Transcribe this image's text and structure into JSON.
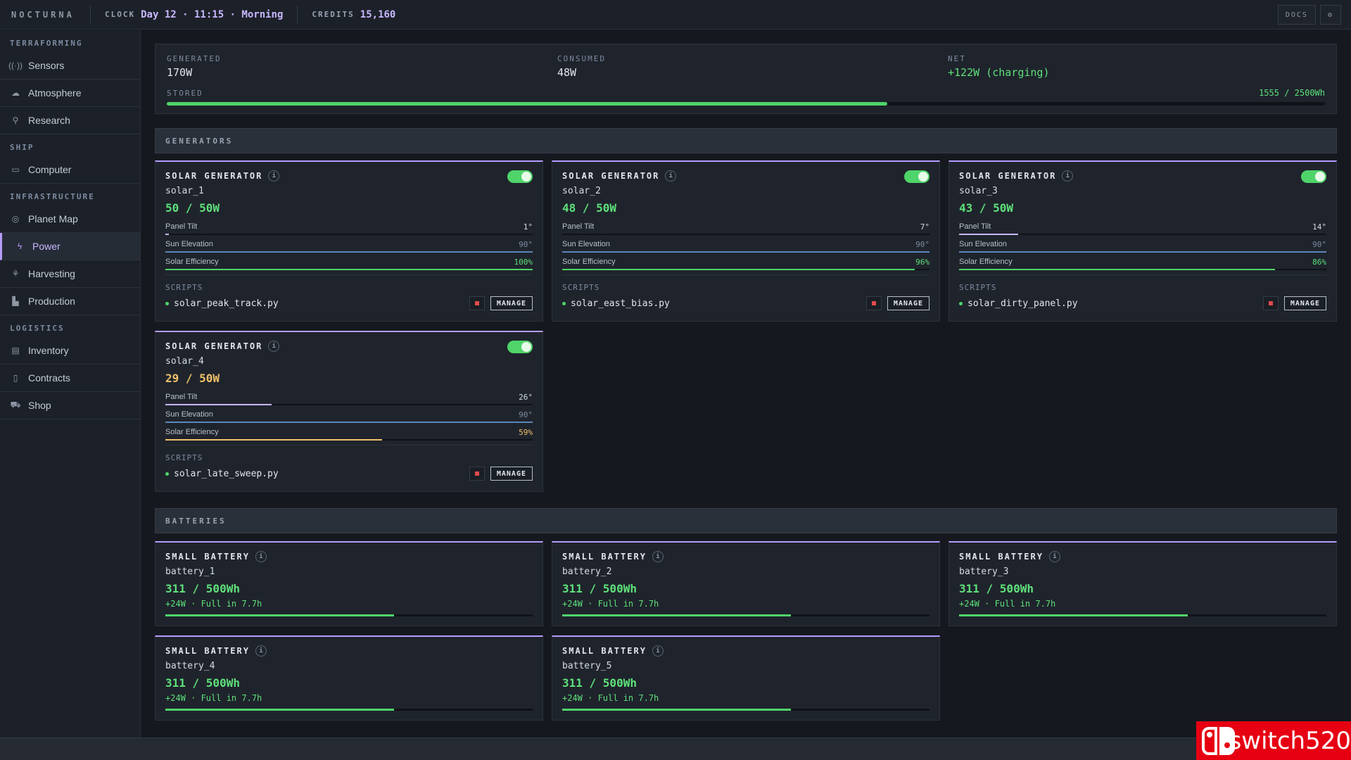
{
  "header": {
    "brand": "NOCTURNA",
    "clock_label": "CLOCK",
    "clock_value": "Day 12 · 11:15 · Morning",
    "credits_label": "CREDITS",
    "credits_value": "15,160",
    "docs_label": "DOCS",
    "settings_icon": "gear-icon"
  },
  "sidebar": {
    "sections": [
      {
        "title": "TERRAFORMING",
        "items": [
          {
            "label": "Sensors",
            "icon": "sensor-icon"
          },
          {
            "label": "Atmosphere",
            "icon": "cloud-icon"
          },
          {
            "label": "Research",
            "icon": "search-icon"
          }
        ]
      },
      {
        "title": "SHIP",
        "items": [
          {
            "label": "Computer",
            "icon": "monitor-icon"
          }
        ]
      },
      {
        "title": "INFRASTRUCTURE",
        "items": [
          {
            "label": "Planet Map",
            "icon": "globe-icon"
          },
          {
            "label": "Power",
            "icon": "lightning-icon",
            "active": true
          },
          {
            "label": "Harvesting",
            "icon": "sprout-icon"
          },
          {
            "label": "Production",
            "icon": "factory-icon"
          }
        ]
      },
      {
        "title": "LOGISTICS",
        "items": [
          {
            "label": "Inventory",
            "icon": "box-icon"
          },
          {
            "label": "Contracts",
            "icon": "document-icon"
          },
          {
            "label": "Shop",
            "icon": "cart-icon"
          }
        ]
      }
    ]
  },
  "summary": {
    "generated_label": "GENERATED",
    "generated_value": "170W",
    "consumed_label": "CONSUMED",
    "consumed_value": "48W",
    "net_label": "NET",
    "net_value": "+122W (charging)",
    "stored_label": "STORED",
    "stored_value": "1555 / 2500Wh",
    "stored_fraction": 0.622
  },
  "generators": {
    "section_title": "GENERATORS",
    "items": [
      {
        "type": "SOLAR GENERATOR",
        "id": "solar_1",
        "power": "50 / 50W",
        "warn": false,
        "tilt_label": "Panel Tilt",
        "tilt": "1°",
        "tilt_frac": 0.01,
        "sun_label": "Sun Elevation",
        "sun": "90°",
        "sun_frac": 1.0,
        "eff_label": "Solar Efficiency",
        "eff": "100%",
        "eff_frac": 1.0,
        "scripts_label": "SCRIPTS",
        "script": "solar_peak_track.py",
        "manage": "MANAGE"
      },
      {
        "type": "SOLAR GENERATOR",
        "id": "solar_2",
        "power": "48 / 50W",
        "warn": false,
        "tilt_label": "Panel Tilt",
        "tilt": "7°",
        "tilt_frac": 0.0,
        "sun_label": "Sun Elevation",
        "sun": "90°",
        "sun_frac": 1.0,
        "eff_label": "Solar Efficiency",
        "eff": "96%",
        "eff_frac": 0.96,
        "scripts_label": "SCRIPTS",
        "script": "solar_east_bias.py",
        "manage": "MANAGE"
      },
      {
        "type": "SOLAR GENERATOR",
        "id": "solar_3",
        "power": "43 / 50W",
        "warn": false,
        "tilt_label": "Panel Tilt",
        "tilt": "14°",
        "tilt_frac": 0.16,
        "sun_label": "Sun Elevation",
        "sun": "90°",
        "sun_frac": 1.0,
        "eff_label": "Solar Efficiency",
        "eff": "86%",
        "eff_frac": 0.86,
        "scripts_label": "SCRIPTS",
        "script": "solar_dirty_panel.py",
        "manage": "MANAGE"
      },
      {
        "type": "SOLAR GENERATOR",
        "id": "solar_4",
        "power": "29 / 50W",
        "warn": true,
        "tilt_label": "Panel Tilt",
        "tilt": "26°",
        "tilt_frac": 0.29,
        "sun_label": "Sun Elevation",
        "sun": "90°",
        "sun_frac": 1.0,
        "eff_label": "Solar Efficiency",
        "eff": "59%",
        "eff_frac": 0.59,
        "scripts_label": "SCRIPTS",
        "script": "solar_late_sweep.py",
        "manage": "MANAGE"
      }
    ]
  },
  "batteries": {
    "section_title": "BATTERIES",
    "items": [
      {
        "type": "SMALL BATTERY",
        "id": "battery_1",
        "charge": "311 / 500Wh",
        "rate": "+24W · Full in 7.7h",
        "frac": 0.622
      },
      {
        "type": "SMALL BATTERY",
        "id": "battery_2",
        "charge": "311 / 500Wh",
        "rate": "+24W · Full in 7.7h",
        "frac": 0.622
      },
      {
        "type": "SMALL BATTERY",
        "id": "battery_3",
        "charge": "311 / 500Wh",
        "rate": "+24W · Full in 7.7h",
        "frac": 0.622
      },
      {
        "type": "SMALL BATTERY",
        "id": "battery_4",
        "charge": "311 / 500Wh",
        "rate": "+24W · Full in 7.7h",
        "frac": 0.622
      },
      {
        "type": "SMALL BATTERY",
        "id": "battery_5",
        "charge": "311 / 500Wh",
        "rate": "+24W · Full in 7.7h",
        "frac": 0.622
      }
    ]
  },
  "watermark": {
    "text": "switch520"
  },
  "colors": {
    "accent": "#b69cff",
    "positive": "#5ee07a",
    "warning": "#f0c069",
    "stop": "#e24b4b"
  }
}
